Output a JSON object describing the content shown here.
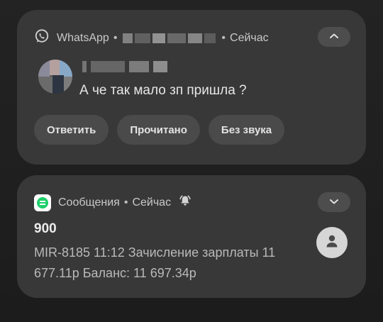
{
  "whatsapp": {
    "app_name": "WhatsApp",
    "dot": "•",
    "time": "Сейчас",
    "message": "А че так мало зп пришла ?",
    "actions": [
      "Ответить",
      "Прочитано",
      "Без звука"
    ],
    "chevron_icon": "chevron-up-icon",
    "app_icon": "whatsapp-icon"
  },
  "sms": {
    "app_name": "Сообщения",
    "dot": "•",
    "time": "Сейчас",
    "alert_icon": "bell-ringing-icon",
    "sender": "900",
    "body": "MIR-8185 11:12 Зачисление зарплаты 11 677.11р Баланс: 11 697.34р",
    "chevron_icon": "chevron-down-icon",
    "avatar_icon": "person-icon",
    "app_icon_color": "#1ecf6a"
  },
  "colors": {
    "card": "#383838",
    "button": "#4a4a4a",
    "background": "#1f1f1f"
  }
}
